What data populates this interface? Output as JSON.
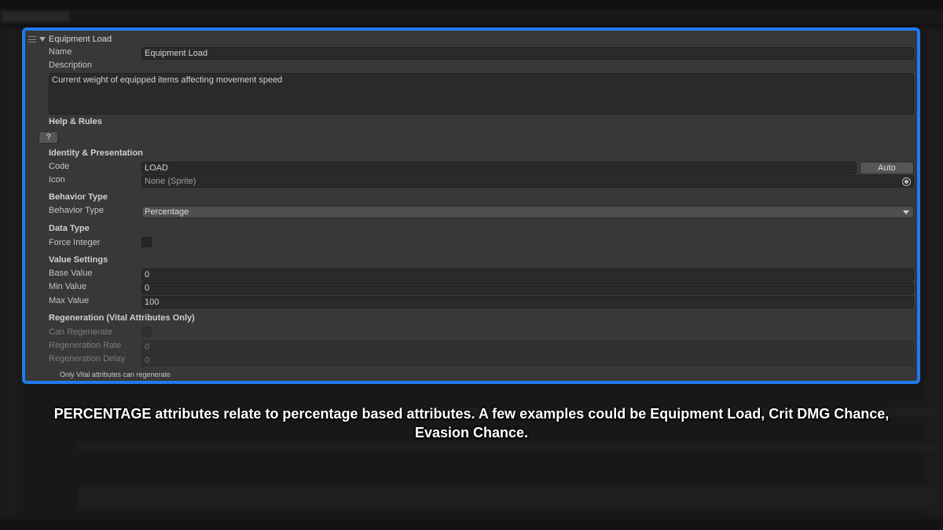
{
  "accent_color": "#1e7cf0",
  "panel": {
    "foldout_title": "Equipment Load",
    "name": {
      "label": "Name",
      "value": "Equipment Load"
    },
    "description": {
      "label": "Description",
      "value": "Current weight of equipped items affecting movement speed"
    },
    "help": {
      "header": "Help & Rules",
      "button": "?"
    },
    "identity": {
      "header": "Identity & Presentation",
      "code": {
        "label": "Code",
        "value": "LOAD",
        "button": "Auto"
      },
      "icon": {
        "label": "Icon",
        "value": "None (Sprite)",
        "icon_name": "object-picker-icon"
      }
    },
    "behavior": {
      "header": "Behavior Type",
      "type": {
        "label": "Behavior Type",
        "value": "Percentage",
        "icon_name": "chevron-down-icon"
      }
    },
    "data_type": {
      "header": "Data Type",
      "force_integer": {
        "label": "Force Integer",
        "checked": false
      }
    },
    "value_settings": {
      "header": "Value Settings",
      "base": {
        "label": "Base Value",
        "value": "0"
      },
      "min": {
        "label": "Min Value",
        "value": "0"
      },
      "max": {
        "label": "Max Value",
        "value": "100"
      }
    },
    "regeneration": {
      "header": "Regeneration (Vital Attributes Only)",
      "can_regenerate": {
        "label": "Can Regenerate",
        "checked": false
      },
      "rate": {
        "label": "Regeneration Rate",
        "value": "0"
      },
      "delay": {
        "label": "Regeneration Delay",
        "value": "0"
      },
      "note": "Only Vital attributes can regenerate"
    }
  },
  "caption": "PERCENTAGE attributes relate to percentage based attributes. A few examples could be Equipment Load, Crit DMG Chance, Evasion Chance."
}
